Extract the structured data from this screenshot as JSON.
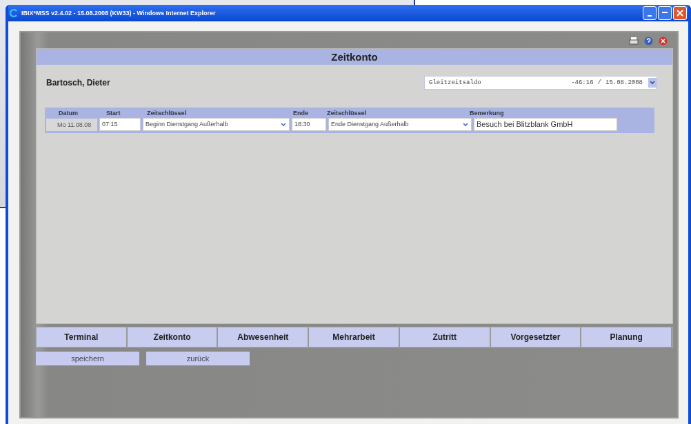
{
  "window": {
    "title": "IBIX*MSS v2.4.02 - 15.08.2008 (KW33) - Windows Internet Explorer"
  },
  "panel": {
    "title": "Zeitkonto"
  },
  "employee": "Bartosch, Dieter",
  "balance": {
    "label": "Gleitzeitsaldo",
    "value": "-46:16",
    "separator": "/",
    "date": "15.08.2008"
  },
  "table": {
    "columns": [
      "Datum",
      "Start",
      "Zeitschlüssel",
      "Ende",
      "Zeitschlüssel",
      "Bemerkung"
    ],
    "rows": [
      {
        "date": "Mo 11.08.08",
        "start": "07:15",
        "start_key": "Beginn Dienstgang Außerhalb",
        "end": "18:30",
        "end_key": "Ende Dienstgang Außerhalb",
        "remark": "Besuch bei Blitzblank GmbH"
      }
    ]
  },
  "nav": [
    "Terminal",
    "Zeitkonto",
    "Abwesenheit",
    "Mehrarbeit",
    "Zutritt",
    "Vorgesetzter",
    "Planung"
  ],
  "buttons": [
    "speichern",
    "zurück"
  ]
}
